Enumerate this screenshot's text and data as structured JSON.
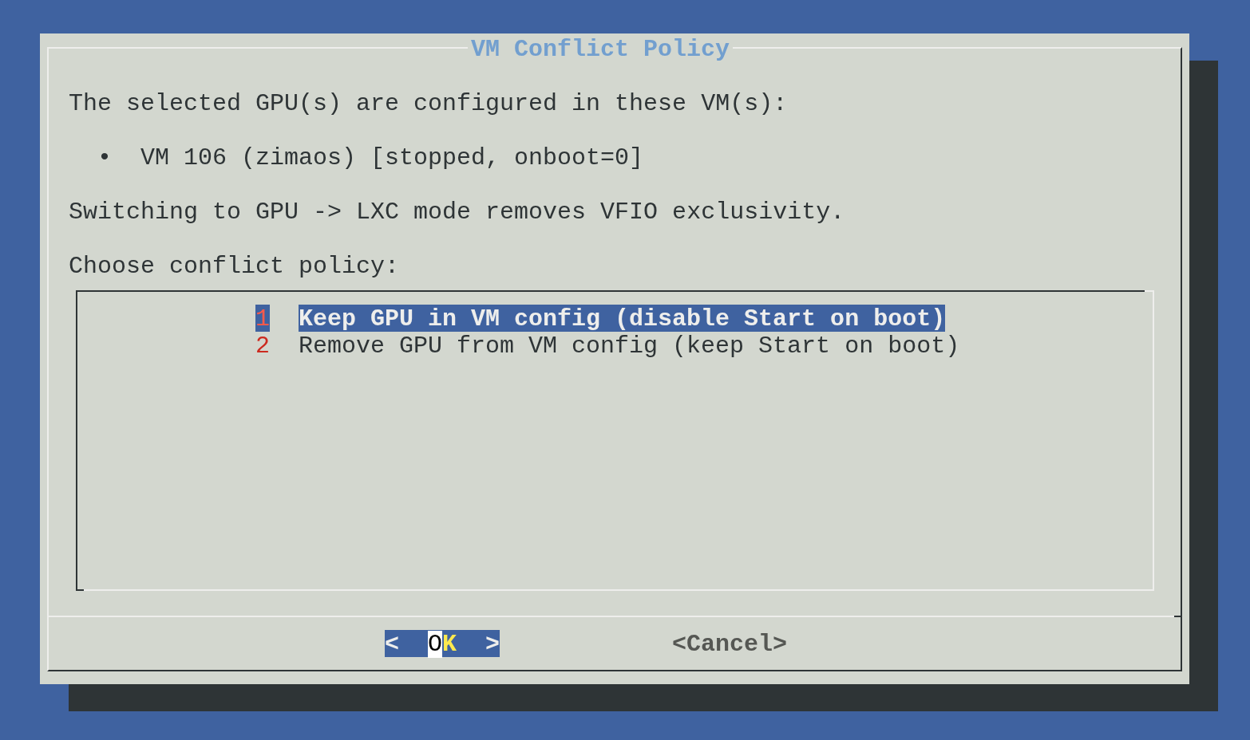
{
  "dialog": {
    "title": "VM Conflict Policy",
    "message": [
      {
        "kind": "text",
        "text": "The selected GPU(s) are configured in these VM(s):"
      },
      {
        "kind": "bullet",
        "text": "•  VM 106 (zimaos) [stopped, onboot=0]"
      },
      {
        "kind": "text",
        "text": "Switching to GPU -> LXC mode removes VFIO exclusivity."
      },
      {
        "kind": "text",
        "text": "Choose conflict policy:"
      }
    ],
    "menu": {
      "items": [
        {
          "tag": "1",
          "label": "Keep GPU in VM config (disable Start on boot)",
          "selected": true
        },
        {
          "tag": "2",
          "label": "Remove GPU from VM config (keep Start on boot)",
          "selected": false
        }
      ]
    },
    "buttons": [
      {
        "open": "<",
        "label": "OK",
        "close": ">",
        "selected": true
      },
      {
        "open": "<",
        "label": "Cancel",
        "close": ">",
        "selected": false
      }
    ]
  }
}
